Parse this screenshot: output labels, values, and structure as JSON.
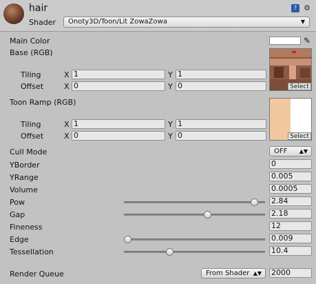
{
  "header": {
    "material_name": "hair",
    "shader_label": "Shader",
    "shader_value": "Onoty3D/Toon/Lit ZowaZowa"
  },
  "main_color": {
    "label": "Main Color",
    "color": "#ffffff"
  },
  "base": {
    "label": "Base (RGB)",
    "tiling_label": "Tiling",
    "offset_label": "Offset",
    "tiling_x": "1",
    "tiling_y": "1",
    "offset_x": "0",
    "offset_y": "0",
    "select_label": "Select"
  },
  "toon_ramp": {
    "label": "Toon Ramp (RGB)",
    "tiling_label": "Tiling",
    "offset_label": "Offset",
    "tiling_x": "1",
    "tiling_y": "1",
    "offset_x": "0",
    "offset_y": "0",
    "select_label": "Select",
    "ramp_colors": [
      "#f0c8a0",
      "#ffffff"
    ]
  },
  "axis": {
    "x": "X",
    "y": "Y"
  },
  "cull_mode": {
    "label": "Cull Mode",
    "value": "OFF"
  },
  "props": {
    "yborder": {
      "label": "YBorder",
      "value": "0"
    },
    "yrange": {
      "label": "YRange",
      "value": "0.005"
    },
    "volume": {
      "label": "Volume",
      "value": "0.0005"
    },
    "pow": {
      "label": "Pow",
      "value": "2.84",
      "slider_fraction": 0.94
    },
    "gap": {
      "label": "Gap",
      "value": "2.18",
      "slider_fraction": 0.59
    },
    "fineness": {
      "label": "Fineness",
      "value": "12"
    },
    "edge": {
      "label": "Edge",
      "value": "0.009",
      "slider_fraction": 0.0
    },
    "tessellation": {
      "label": "Tessellation",
      "value": "10.4",
      "slider_fraction": 0.31
    }
  },
  "render_queue": {
    "label": "Render Queue",
    "mode": "From Shader",
    "value": "2000"
  },
  "icons": [
    "material-thumbnail-icon",
    "help-book-icon",
    "settings-gear-icon",
    "color-picker-icon",
    "dropdown-arrow-icon"
  ]
}
